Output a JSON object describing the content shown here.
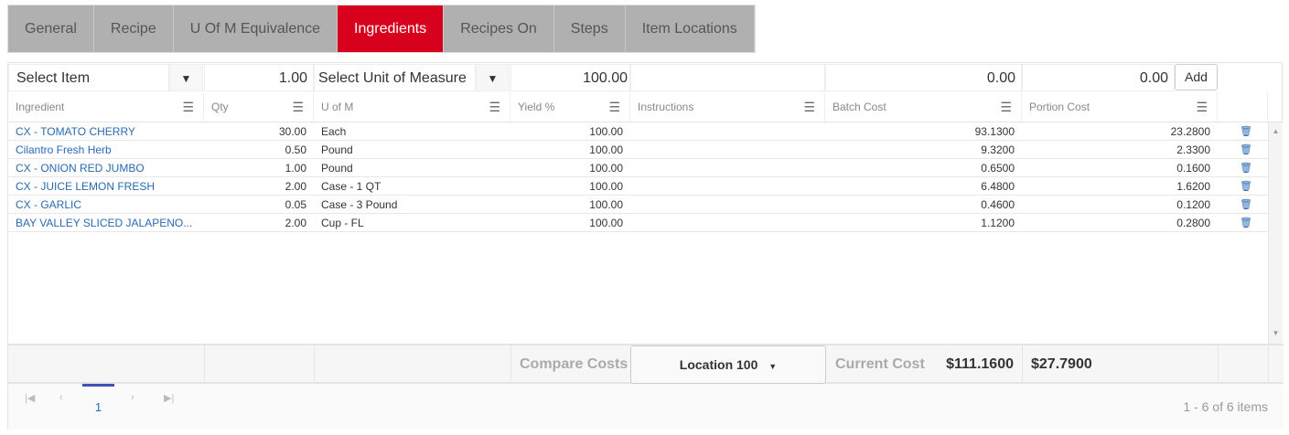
{
  "tabs": [
    "General",
    "Recipe",
    "U Of M Equivalence",
    "Ingredients",
    "Recipes On",
    "Steps",
    "Item Locations"
  ],
  "active_tab": "Ingredients",
  "entry": {
    "item_placeholder": "Select Item",
    "qty": "1.00",
    "uom_placeholder": "Select Unit of Measure",
    "yield": "100.00",
    "batch": "0.00",
    "portion": "0.00",
    "add_label": "Add"
  },
  "columns": [
    "Ingredient",
    "Qty",
    "U of M",
    "Yield %",
    "Instructions",
    "Batch Cost",
    "Portion Cost"
  ],
  "rows": [
    {
      "ingredient": "CX - TOMATO CHERRY",
      "qty": "30.00",
      "uom": "Each",
      "yield": "100.00",
      "instructions": "",
      "batch": "93.1300",
      "portion": "23.2800"
    },
    {
      "ingredient": "Cilantro Fresh Herb",
      "qty": "0.50",
      "uom": "Pound",
      "yield": "100.00",
      "instructions": "",
      "batch": "9.3200",
      "portion": "2.3300"
    },
    {
      "ingredient": "CX - ONION RED JUMBO",
      "qty": "1.00",
      "uom": "Pound",
      "yield": "100.00",
      "instructions": "",
      "batch": "0.6500",
      "portion": "0.1600"
    },
    {
      "ingredient": "CX - JUICE LEMON FRESH",
      "qty": "2.00",
      "uom": "Case - 1 QT",
      "yield": "100.00",
      "instructions": "",
      "batch": "6.4800",
      "portion": "1.6200"
    },
    {
      "ingredient": "CX - GARLIC",
      "qty": "0.05",
      "uom": "Case - 3 Pound",
      "yield": "100.00",
      "instructions": "",
      "batch": "0.4600",
      "portion": "0.1200"
    },
    {
      "ingredient": "BAY VALLEY SLICED JALAPENO...",
      "qty": "2.00",
      "uom": "Cup - FL",
      "yield": "100.00",
      "instructions": "",
      "batch": "1.1200",
      "portion": "0.2800"
    }
  ],
  "footer": {
    "compare_label": "Compare Costs",
    "location": "Location 100",
    "current_label": "Current Cost",
    "batch_total": "$111.1600",
    "portion_total": "$27.7900"
  },
  "pager": {
    "page": "1",
    "summary": "1 - 6 of 6 items"
  }
}
